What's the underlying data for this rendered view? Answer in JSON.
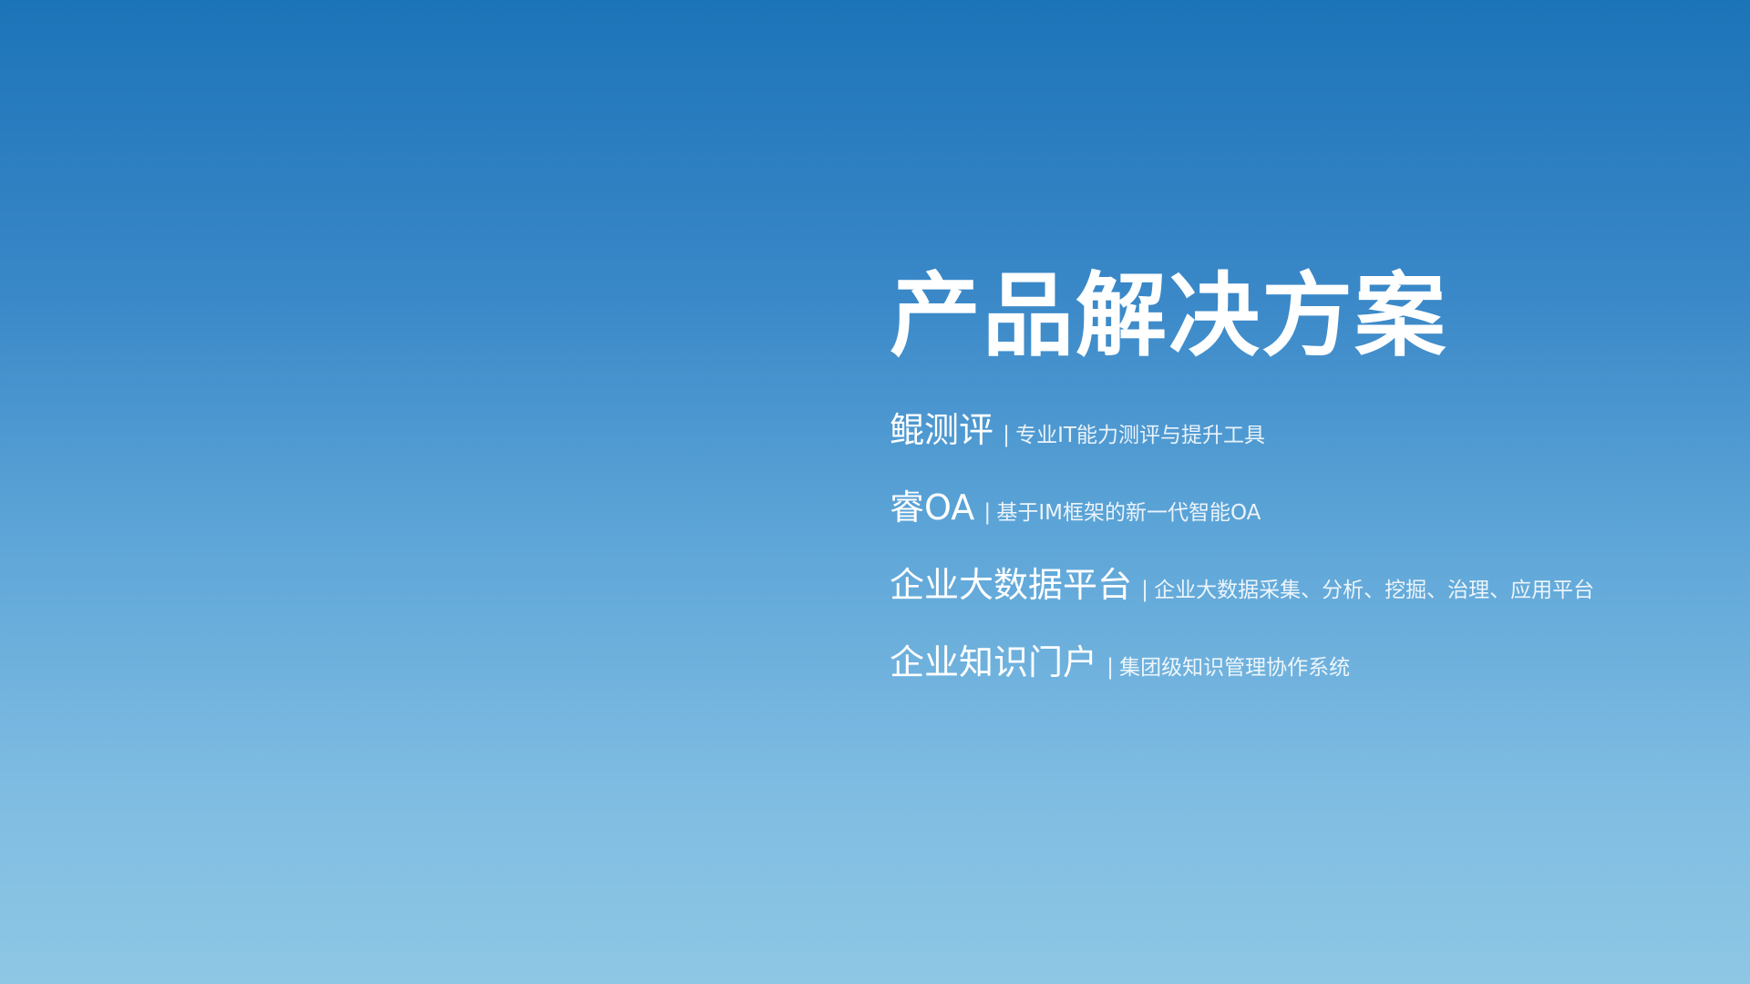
{
  "title": "产品解决方案",
  "separator": "|",
  "products": [
    {
      "name": "鲲测评",
      "desc": "专业IT能力测评与提升工具"
    },
    {
      "name": "睿OA",
      "desc": "基于IM框架的新一代智能OA"
    },
    {
      "name": "企业大数据平台",
      "desc": "企业大数据采集、分析、挖掘、治理、应用平台"
    },
    {
      "name": "企业知识门户",
      "desc": "集团级知识管理协作系统"
    }
  ],
  "colors": {
    "gradient_top": "#1c74b8",
    "gradient_bottom": "#8ec7e4",
    "text": "#ffffff"
  }
}
